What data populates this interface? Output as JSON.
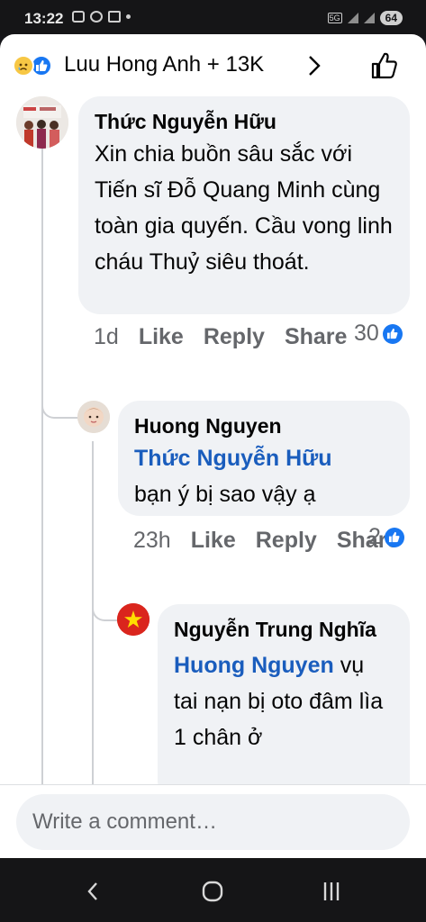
{
  "status_bar": {
    "time": "13:22",
    "network": "5G",
    "battery": "64"
  },
  "header": {
    "title": "Luu Hong Anh + 13K",
    "reactions": [
      "sad-reaction-icon",
      "like-reaction-icon"
    ]
  },
  "comments": [
    {
      "author": "Thức Nguyễn Hữu",
      "text": "Xin chia buồn sâu sắc với Tiến sĩ Đỗ Quang Minh cùng toàn gia quyến. Cầu vong linh cháu Thuỷ siêu thoát.",
      "time": "1d",
      "like_label": "Like",
      "reply_label": "Reply",
      "share_label": "Share",
      "reaction_count": "30"
    },
    {
      "author": "Huong Nguyen",
      "mention": "Thức Nguyễn Hữu",
      "text": "bạn ý bị sao vậy ạ",
      "time": "23h",
      "like_label": "Like",
      "reply_label": "Reply",
      "share_label": "Share",
      "reaction_count": "2"
    },
    {
      "author": "Nguyễn Trung Nghĩa",
      "mention": "Huong Nguyen",
      "text": " vụ tai nạn bị oto đâm lìa 1 chân ở"
    }
  ],
  "composer": {
    "placeholder": "Write a comment…"
  },
  "colors": {
    "accent": "#1877f2",
    "mention": "#1a5dbd",
    "bubble": "#f0f2f5",
    "meta": "#65676b"
  }
}
